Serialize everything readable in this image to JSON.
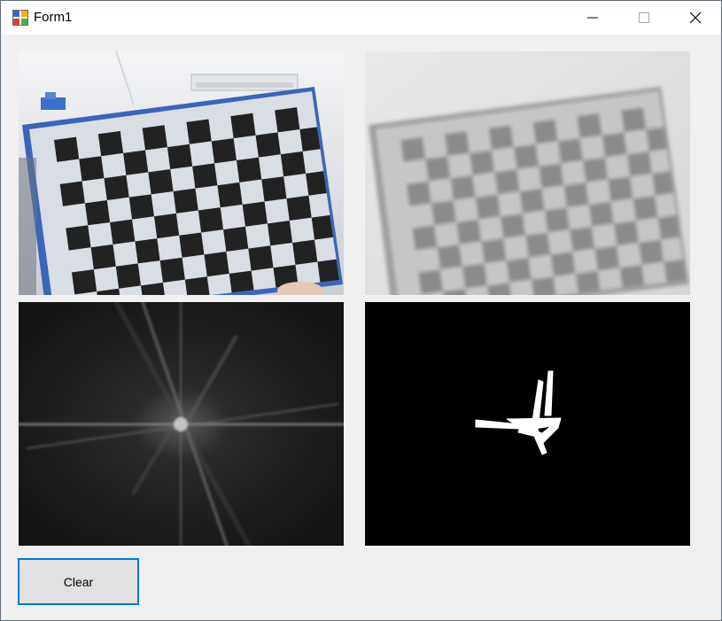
{
  "window": {
    "title": "Form1"
  },
  "title_bar": {
    "minimize_icon": "minimize-icon",
    "maximize_icon": "maximize-icon",
    "close_icon": "close-icon"
  },
  "panels": [
    {
      "name": "camera-image",
      "description_icon": "photo"
    },
    {
      "name": "blurred-image",
      "description_icon": "photo"
    },
    {
      "name": "fft-spectrum-image",
      "description_icon": "photo"
    },
    {
      "name": "binary-mask-image",
      "description_icon": "photo"
    }
  ],
  "buttons": {
    "clear_label": "Clear"
  },
  "colors": {
    "form_background": "#f0f0f0",
    "titlebar_background": "#ffffff",
    "button_focus_border": "#0078d7",
    "button_face": "#e1e1e1"
  }
}
